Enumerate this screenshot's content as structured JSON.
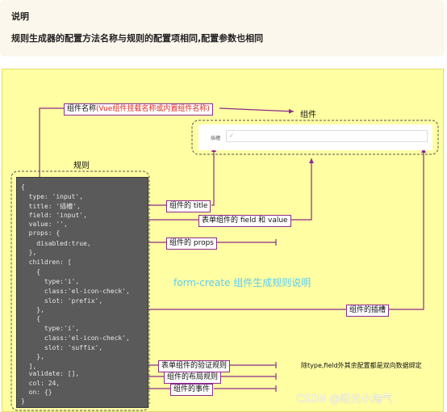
{
  "note": {
    "title": "说明",
    "text": "规则生成器的配置方法名称与规则的配置项相同,配置参数也相同"
  },
  "diagram": {
    "component_name_label": "组件名称",
    "component_name_hint": "(Vue组件挂载名称或内置组件名称)",
    "component_caption": "组件",
    "rule_caption": "规则",
    "center_title": "form-create 组件生成规则说明",
    "widget": {
      "label": "插槽",
      "prefix_icon": "✓"
    },
    "callouts": {
      "title": "组件的 title",
      "field_value": "表单组件的 field 和 value",
      "props": "组件的 props",
      "slot": "组件的插槽",
      "validate": "表单组件的验证规则",
      "col": "组件的布局规则",
      "on": "组件的事件"
    },
    "side_note": "除type,field外其余配置都是双向数据绑定",
    "watermark": "CSDN @阳光小淘气"
  },
  "code": {
    "l1": "{",
    "l2": "  type: 'input',",
    "l3": "  title: '插槽',",
    "l4": "  field: 'input',",
    "l5": "  value: '',",
    "l6": "  props: {",
    "l7": "    disabled:true,",
    "l8": "  },",
    "l9": "  children: [",
    "l10": "    {",
    "l11": "      type:'i',",
    "l12": "      class:'el-icon-check',",
    "l13": "      slot: 'prefix',",
    "l14": "    },",
    "l15": "    {",
    "l16": "      type:'i',",
    "l17": "      class:'el-icon-check',",
    "l18": "      slot: 'suffix',",
    "l19": "    },",
    "l20": "  ],",
    "l21": "  validate: [],",
    "l22": "  col: 24,",
    "l23": "  on: {}",
    "l24": "}"
  },
  "colors": {
    "connector": "#8d2b8d",
    "background": "#fffea3",
    "code_bg": "#5a5a5a",
    "hint_red": "#e3261c",
    "title_blue": "#5ecbf0"
  }
}
